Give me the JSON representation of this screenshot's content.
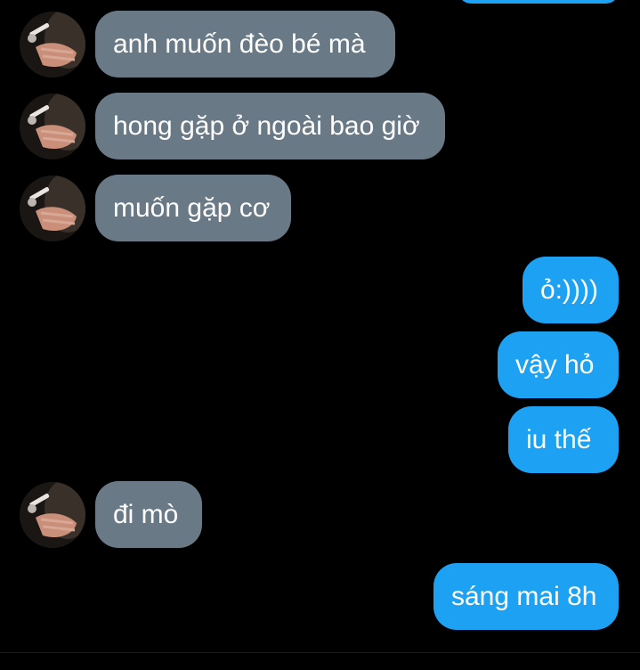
{
  "conversation": {
    "messages": [
      {
        "direction": "incoming",
        "text": "anh muốn đèo bé mà"
      },
      {
        "direction": "incoming",
        "text": "hong gặp ở ngoài bao giờ"
      },
      {
        "direction": "incoming",
        "text": "muốn gặp cơ"
      },
      {
        "direction": "outgoing",
        "text": "ỏ:))))"
      },
      {
        "direction": "outgoing",
        "text": "vậy hỏ"
      },
      {
        "direction": "outgoing",
        "text": "iu thế"
      },
      {
        "direction": "incoming",
        "text": "đi mò"
      },
      {
        "direction": "outgoing",
        "text": "sáng mai 8h"
      }
    ]
  },
  "colors": {
    "background": "#000000",
    "incoming_bubble": "#6a7986",
    "outgoing_bubble": "#1da1f2",
    "text": "#ffffff"
  },
  "icons": {
    "avatar": "contact-avatar-photo"
  }
}
